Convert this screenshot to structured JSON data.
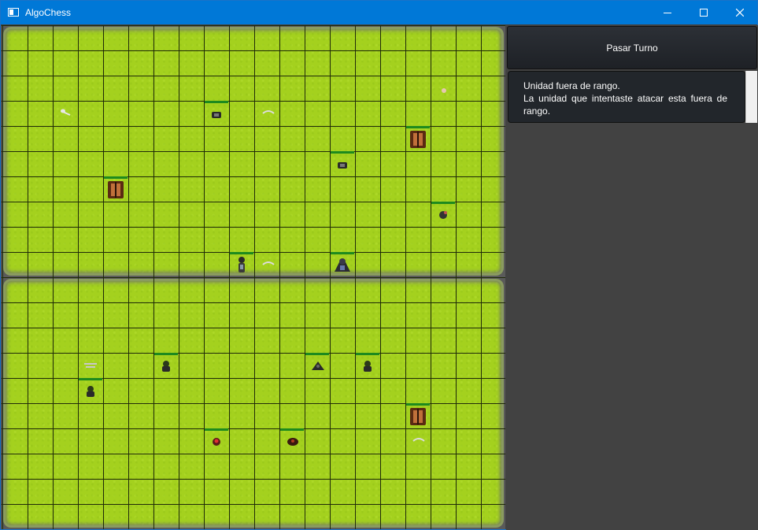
{
  "window": {
    "title": "AlgoChess"
  },
  "controls": {
    "minimize": "minimize-icon",
    "maximize": "maximize-icon",
    "close": "close-icon"
  },
  "sidebar": {
    "pass_turn_label": "Pasar Turno",
    "message": {
      "title": "Unidad fuera de rango.",
      "body": "La unidad que intentaste atacar esta fuera de rango."
    }
  },
  "colors": {
    "titlebar": "#0078d7",
    "grass": "#a4d11e",
    "health": "#1e8a1e",
    "panel": "#424242"
  }
}
